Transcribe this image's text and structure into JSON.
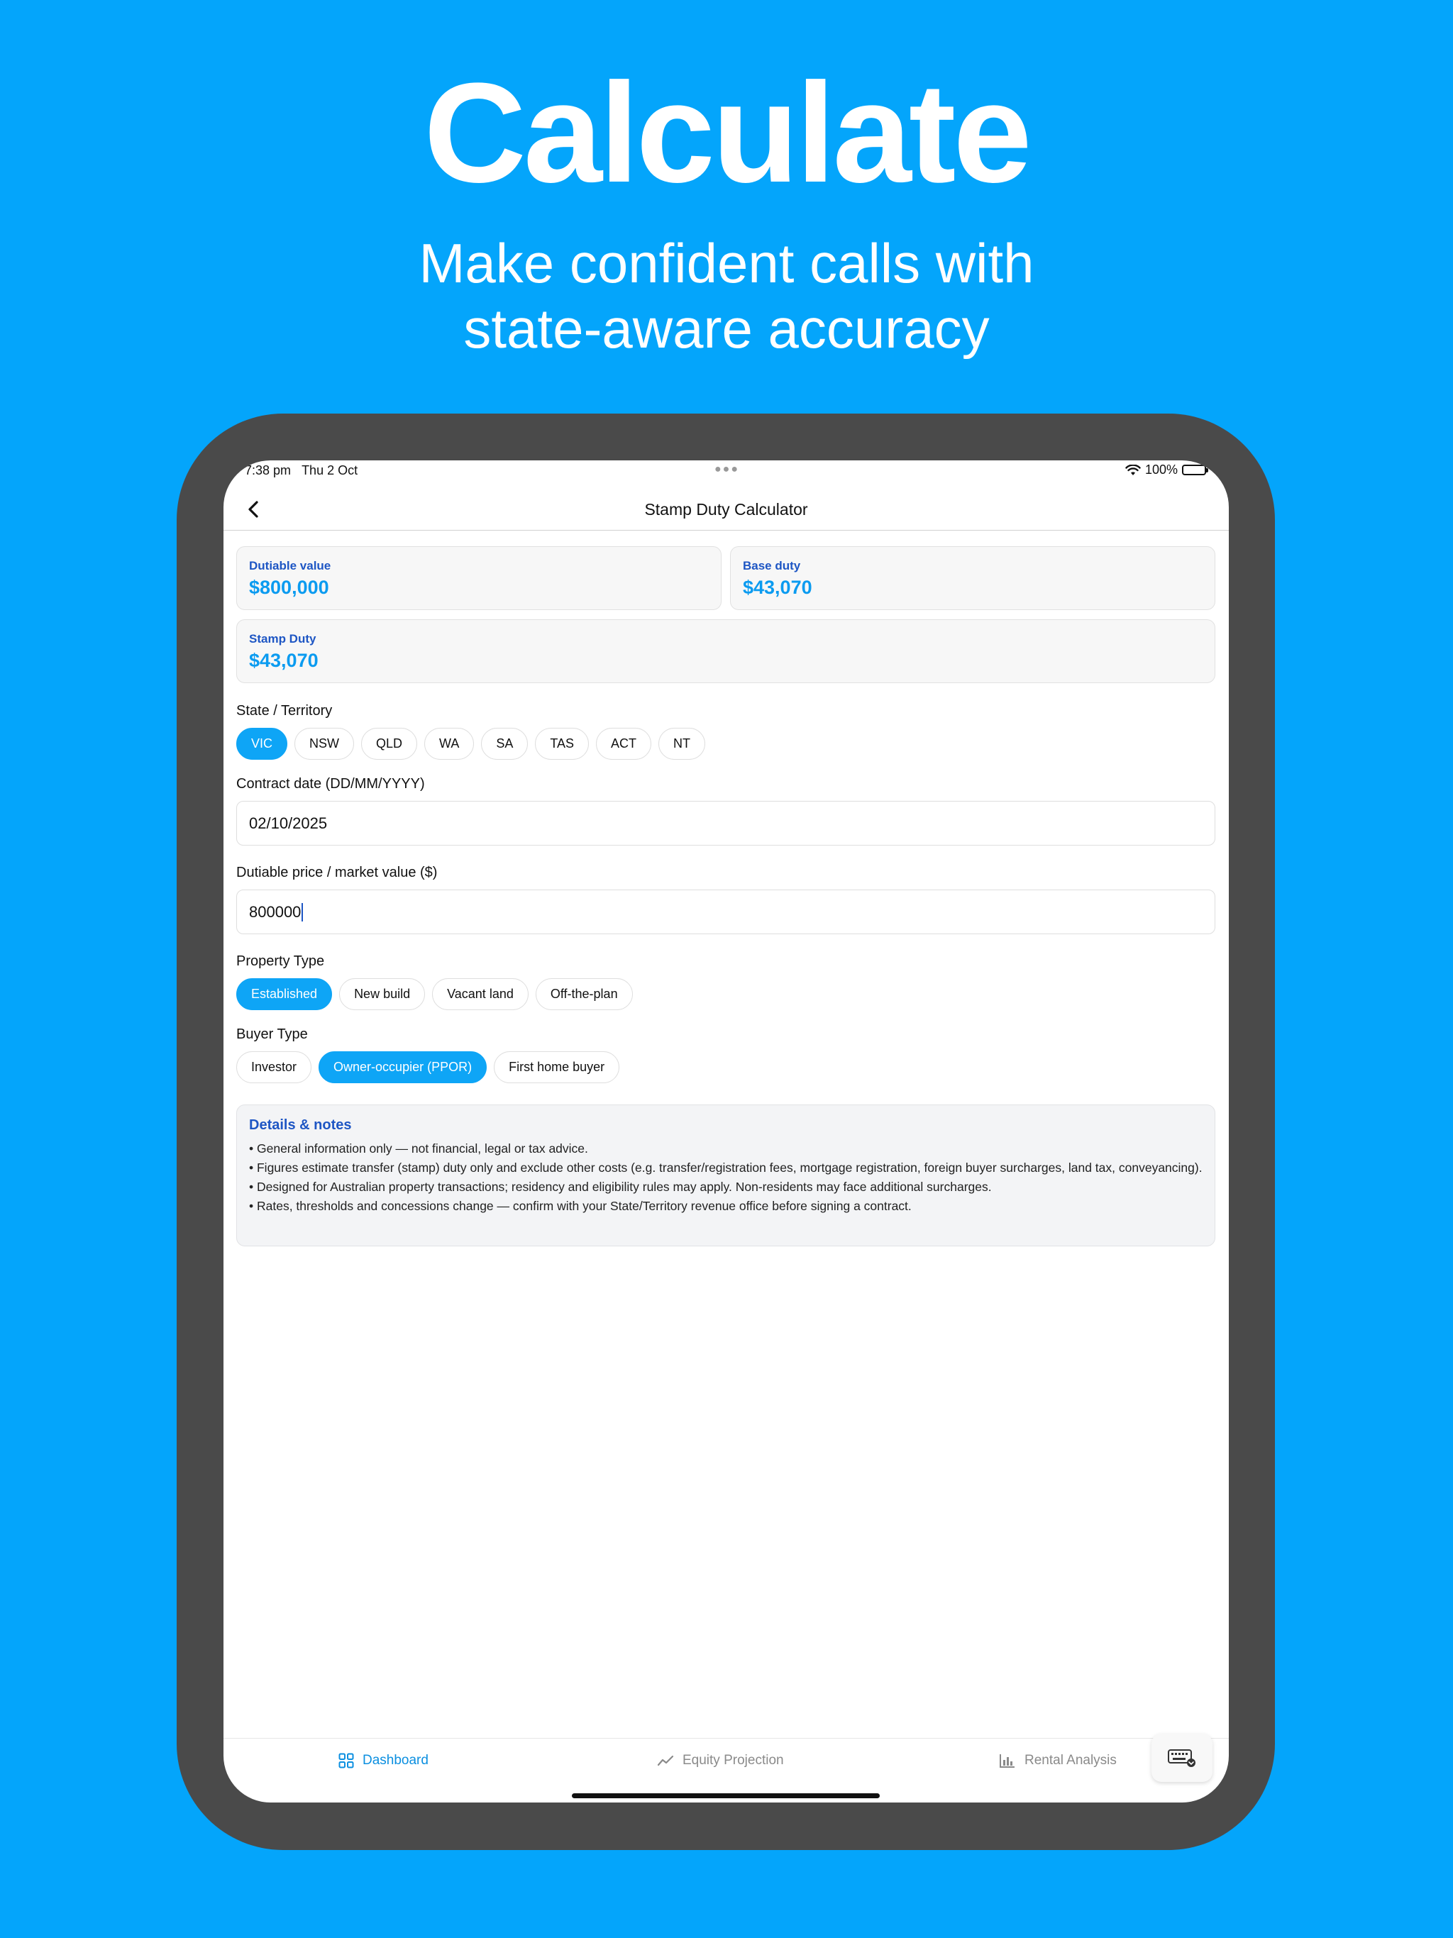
{
  "hero": {
    "title": "Calculate",
    "subtitle_line1": "Make confident calls with",
    "subtitle_line2": "state-aware accuracy"
  },
  "status_bar": {
    "time": "7:38 pm",
    "date": "Thu 2 Oct",
    "battery": "100%"
  },
  "nav": {
    "title": "Stamp Duty Calculator"
  },
  "summary": {
    "dutiable_label": "Dutiable value",
    "dutiable_value": "$800,000",
    "base_label": "Base duty",
    "base_value": "$43,070",
    "stamp_label": "Stamp Duty",
    "stamp_value": "$43,070"
  },
  "state": {
    "label": "State / Territory",
    "options": [
      "VIC",
      "NSW",
      "QLD",
      "WA",
      "SA",
      "TAS",
      "ACT",
      "NT"
    ],
    "selected": "VIC"
  },
  "contract_date": {
    "label": "Contract date (DD/MM/YYYY)",
    "value": "02/10/2025"
  },
  "price": {
    "label": "Dutiable price / market value ($)",
    "value": "800000"
  },
  "property_type": {
    "label": "Property Type",
    "options": [
      "Established",
      "New build",
      "Vacant land",
      "Off-the-plan"
    ],
    "selected": "Established"
  },
  "buyer_type": {
    "label": "Buyer Type",
    "options": [
      "Investor",
      "Owner-occupier (PPOR)",
      "First home buyer"
    ],
    "selected": "Owner-occupier (PPOR)"
  },
  "notes": {
    "title": "Details & notes",
    "lines": [
      "• General information only — not financial, legal or tax advice.",
      "• Figures estimate transfer (stamp) duty only and exclude other costs (e.g. transfer/registration fees, mortgage registration, foreign buyer surcharges, land tax, conveyancing).",
      "• Designed for Australian property transactions; residency and eligibility rules may apply. Non-residents may face additional surcharges.",
      "• Rates, thresholds and concessions change — confirm with your State/Territory revenue office before signing a contract."
    ]
  },
  "tabs": [
    {
      "label": "Dashboard",
      "icon": "grid-icon",
      "active": true
    },
    {
      "label": "Equity Projection",
      "icon": "trend-line-icon",
      "active": false
    },
    {
      "label": "Rental Analysis",
      "icon": "bar-chart-icon",
      "active": false
    }
  ],
  "colors": {
    "background": "#04a5fb",
    "accent": "#0ea5f6",
    "label_blue": "#1e56c4",
    "device": "#4a4a4a"
  }
}
